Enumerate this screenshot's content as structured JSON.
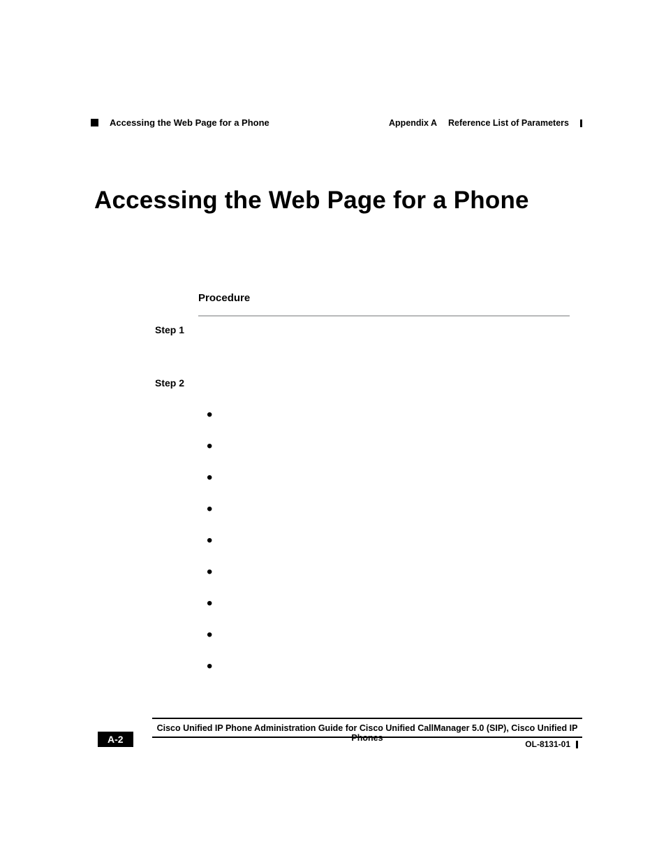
{
  "header": {
    "appendix_label": "Appendix A",
    "appendix_title": "Reference List of Parameters",
    "running_section": "Accessing the Web Page for a Phone"
  },
  "title": "Accessing the Web Page for a Phone",
  "procedure_label": "Procedure",
  "steps": [
    {
      "label": "Step 1"
    },
    {
      "label": "Step 2"
    }
  ],
  "bullets_count": 9,
  "footer": {
    "guide_title": "Cisco Unified IP Phone Administration Guide for Cisco Unified CallManager 5.0 (SIP), Cisco Unified IP Phones",
    "page_number": "A-2",
    "doc_number": "OL-8131-01"
  }
}
